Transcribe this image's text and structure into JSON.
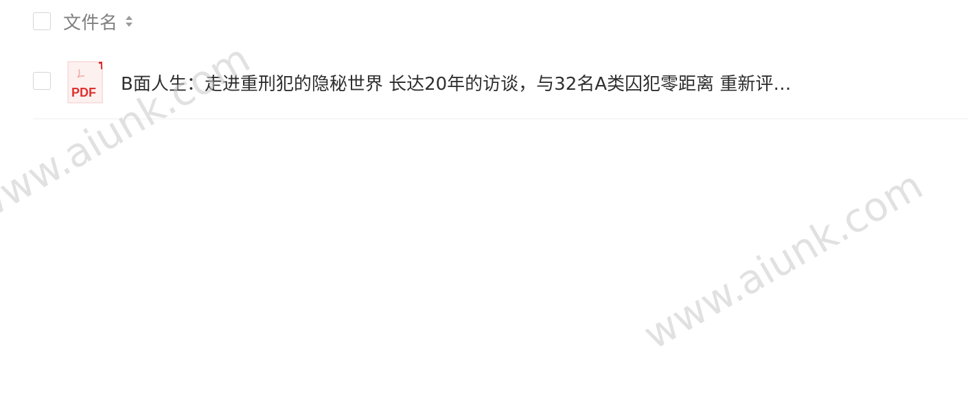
{
  "list": {
    "header": {
      "column_label": "文件名"
    },
    "files": [
      {
        "name": "B面人生：走进重刑犯的隐秘世界 长达20年的访谈，与32名A类囚犯零距离 重新评…",
        "type": "PDF",
        "icon": "pdf-file-icon"
      }
    ]
  },
  "watermark": {
    "text": "www.aiunk.com"
  },
  "colors": {
    "pdf_red": "#e0312f",
    "pdf_bg": "#fdf1f0",
    "text": "#2f2f2f",
    "header_text": "#7f7f7f",
    "watermark": "#c8c8c8"
  }
}
